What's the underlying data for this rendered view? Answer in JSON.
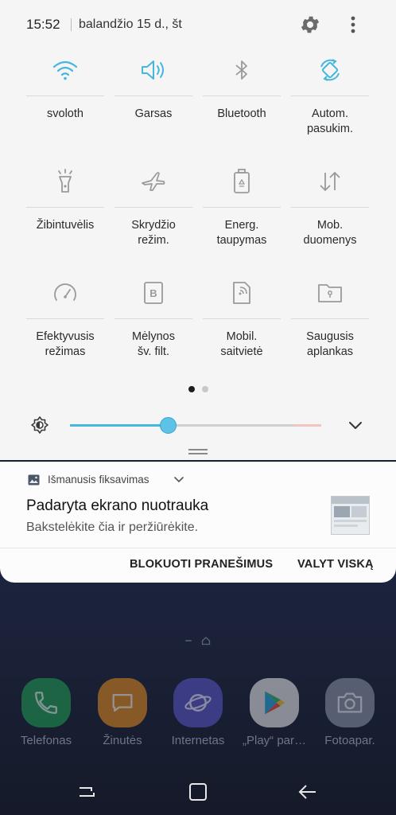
{
  "status": {
    "time": "15:52",
    "date": "balandžio 15 d., št"
  },
  "icons": {
    "settings": "gear-icon",
    "more": "more-vertical-icon"
  },
  "tiles": [
    {
      "label": "svoloth",
      "icon": "wifi-icon",
      "active": true
    },
    {
      "label": "Garsas",
      "icon": "sound-icon",
      "active": true
    },
    {
      "label": "Bluetooth",
      "icon": "bluetooth-icon",
      "active": false
    },
    {
      "label": "Autom.\npasukim.",
      "icon": "auto-rotate-icon",
      "active": true
    },
    {
      "label": "Žibintuvėlis",
      "icon": "flashlight-icon",
      "active": false
    },
    {
      "label": "Skrydžio\nrežim.",
      "icon": "airplane-icon",
      "active": false
    },
    {
      "label": "Energ.\ntaupymas",
      "icon": "battery-saver-icon",
      "active": false
    },
    {
      "label": "Mob.\nduomenys",
      "icon": "mobile-data-icon",
      "active": false
    },
    {
      "label": "Efektyvusis\nrežimas",
      "icon": "performance-icon",
      "active": false
    },
    {
      "label": "Mėlynos\nšv. filt.",
      "icon": "blue-light-filter-icon",
      "active": false
    },
    {
      "label": "Mobil.\nsaitvietė",
      "icon": "hotspot-icon",
      "active": false
    },
    {
      "label": "Saugusis\naplankas",
      "icon": "secure-folder-icon",
      "active": false
    }
  ],
  "pager": {
    "pages": 2,
    "current": 1
  },
  "brightness": {
    "level": 0.39
  },
  "notification": {
    "app": "Išmanusis fiksavimas",
    "title": "Padaryta ekrano nuotrauka",
    "text": "Bakstelėkite čia ir peržiūrėkite.",
    "actions": {
      "block": "BLOKUOTI PRANEŠIMUS",
      "clear": "VALYT VISKĄ"
    }
  },
  "colors": {
    "accent": "#47b6dc",
    "inactive_icon": "#9a9a9a"
  },
  "dock": [
    {
      "label": "Telefonas",
      "icon": "phone-icon",
      "color": "#1f9e53"
    },
    {
      "label": "Žinutės",
      "icon": "messages-icon",
      "color": "#e08a1e"
    },
    {
      "label": "Internetas",
      "icon": "internet-icon",
      "color": "#5a55c8"
    },
    {
      "label": "„Play“ par…",
      "icon": "play-store-icon",
      "color": "#e6e6e6"
    },
    {
      "label": "Fotoapar.",
      "icon": "camera-icon",
      "color": "#8a93a6"
    }
  ]
}
